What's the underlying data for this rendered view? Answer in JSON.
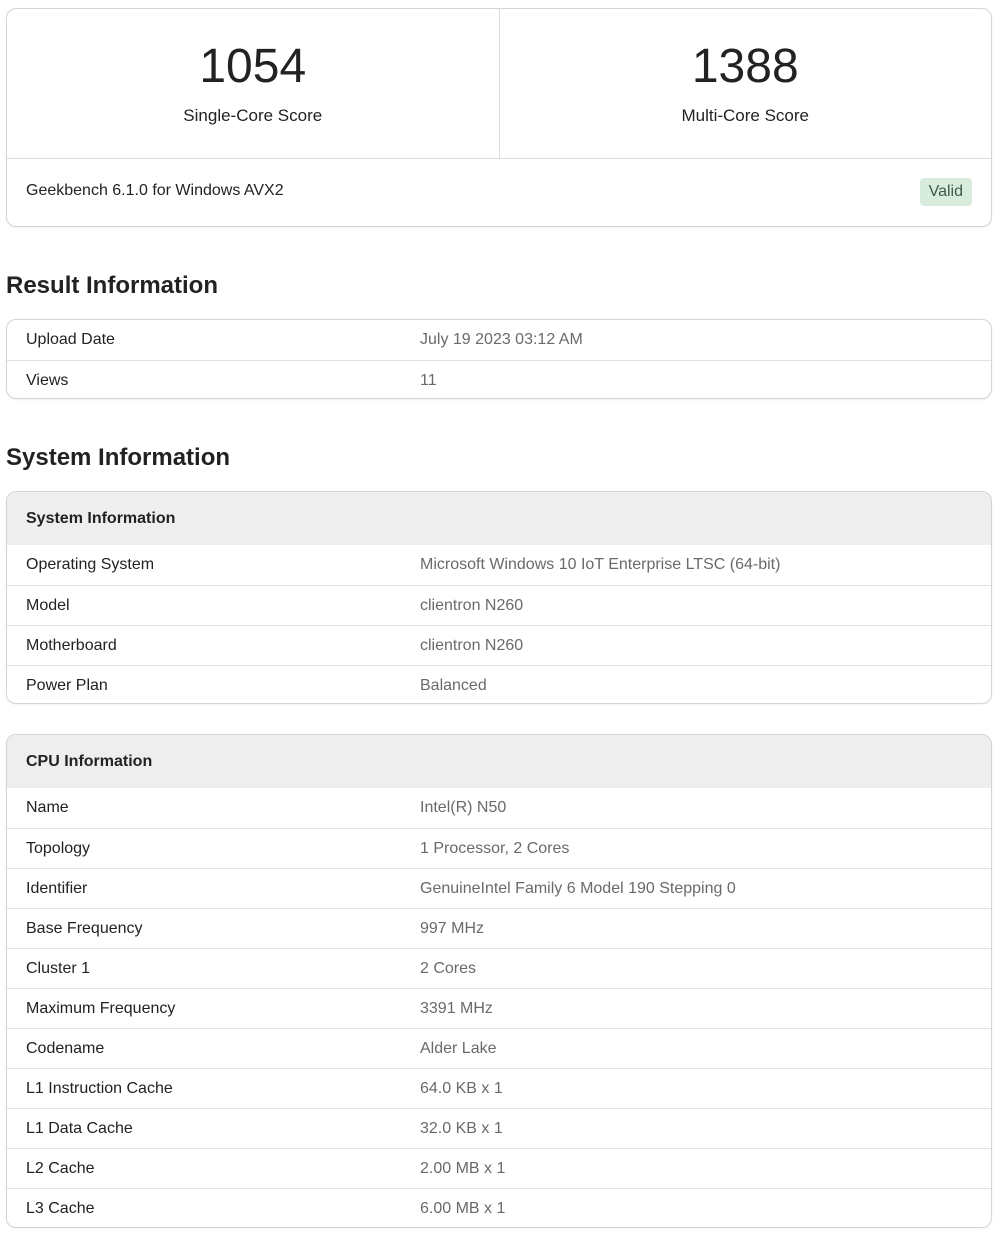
{
  "scores": {
    "single": {
      "value": "1054",
      "label": "Single-Core Score"
    },
    "multi": {
      "value": "1388",
      "label": "Multi-Core Score"
    }
  },
  "version": "Geekbench 6.1.0 for Windows AVX2",
  "status_badge": "Valid",
  "result_section": {
    "heading": "Result Information",
    "rows": [
      {
        "key": "Upload Date",
        "value": "July 19 2023 03:12 AM"
      },
      {
        "key": "Views",
        "value": "11"
      }
    ]
  },
  "system_section": {
    "heading": "System Information",
    "system_card": {
      "title": "System Information",
      "rows": [
        {
          "key": "Operating System",
          "value": "Microsoft Windows 10 IoT Enterprise LTSC (64-bit)"
        },
        {
          "key": "Model",
          "value": "clientron N260"
        },
        {
          "key": "Motherboard",
          "value": "clientron N260"
        },
        {
          "key": "Power Plan",
          "value": "Balanced"
        }
      ]
    },
    "cpu_card": {
      "title": "CPU Information",
      "rows": [
        {
          "key": "Name",
          "value": "Intel(R) N50"
        },
        {
          "key": "Topology",
          "value": "1 Processor, 2 Cores"
        },
        {
          "key": "Identifier",
          "value": "GenuineIntel Family 6 Model 190 Stepping 0"
        },
        {
          "key": "Base Frequency",
          "value": "997 MHz"
        },
        {
          "key": "Cluster 1",
          "value": "2 Cores"
        },
        {
          "key": "Maximum Frequency",
          "value": "3391 MHz"
        },
        {
          "key": "Codename",
          "value": "Alder Lake"
        },
        {
          "key": "L1 Instruction Cache",
          "value": "64.0 KB x 1"
        },
        {
          "key": "L1 Data Cache",
          "value": "32.0 KB x 1"
        },
        {
          "key": "L2 Cache",
          "value": "2.00 MB x 1"
        },
        {
          "key": "L3 Cache",
          "value": "6.00 MB x 1"
        }
      ]
    }
  },
  "colors": {
    "badge_bg": "#d7ecdc",
    "badge_text": "#3d5a44",
    "header_bg": "#eeeeee",
    "value_text": "#6a6a6a"
  }
}
